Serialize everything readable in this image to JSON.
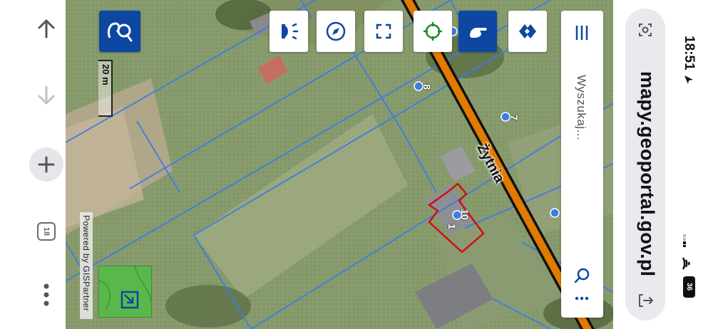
{
  "browser": {
    "url": "mapy.geoportal.gov.pl",
    "nav": {
      "back_icon": "arrow-up-icon",
      "forward_icon": "arrow-down-icon",
      "new_tab_icon": "plus-icon",
      "tab_count": "18",
      "more_icon": "ellipsis-vertical-icon"
    },
    "url_bar_icons": [
      "reader-icon",
      "share-icon"
    ]
  },
  "status_bar": {
    "time": "18:51",
    "battery": "36"
  },
  "map": {
    "street_name": "Żytnia",
    "scale_label": "20 m",
    "attribution": "Powered by GISPartner",
    "search_placeholder": "Wyszukaj...",
    "address_points": [
      "8",
      "7",
      "10",
      "1"
    ],
    "toolbar_icons": [
      "layers-icon",
      "locate-icon",
      "fullscreen-icon",
      "compass-icon",
      "light-icon",
      "measure-icon"
    ],
    "colors": {
      "accent_blue": "#0d47a1",
      "parcel_lines": "#3d7be8",
      "road_fill": "#e07a00",
      "building_outline": "#cc1111",
      "gps_green": "#1a8a2a"
    }
  }
}
